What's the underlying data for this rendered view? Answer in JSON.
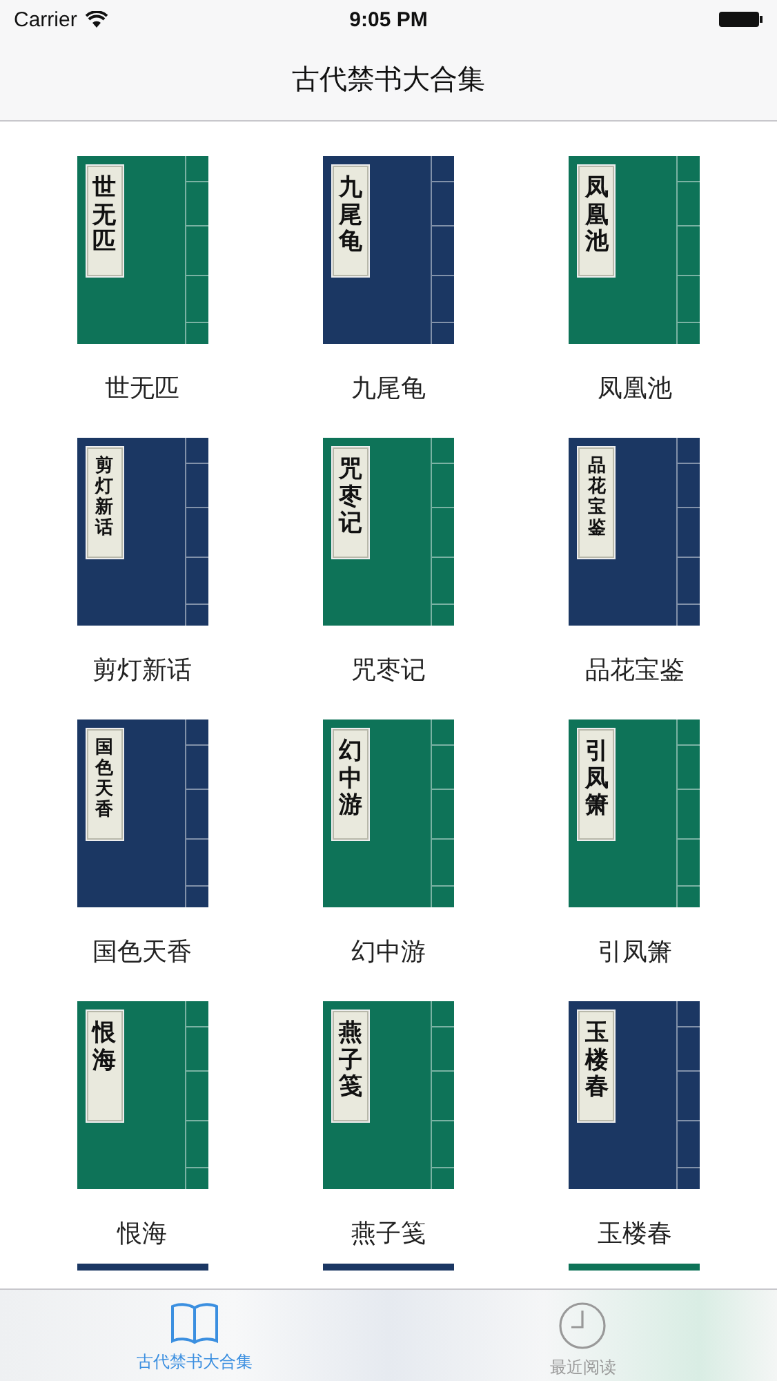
{
  "status_bar": {
    "carrier": "Carrier",
    "time": "9:05 PM"
  },
  "nav_bar": {
    "title": "古代禁书大合集"
  },
  "books": [
    {
      "title": "世无匹",
      "cover_title": "世无匹",
      "color": "#0e7358"
    },
    {
      "title": "九尾龟",
      "cover_title": "九尾龟",
      "color": "#1b3763"
    },
    {
      "title": "凤凰池",
      "cover_title": "凤凰池",
      "color": "#0e7358"
    },
    {
      "title": "剪灯新话",
      "cover_title": "剪灯新话",
      "color": "#1b3763"
    },
    {
      "title": "咒枣记",
      "cover_title": "咒枣记",
      "color": "#0e7358"
    },
    {
      "title": "品花宝鉴",
      "cover_title": "品花宝鉴",
      "color": "#1b3763"
    },
    {
      "title": "国色天香",
      "cover_title": "国色天香",
      "color": "#1b3763"
    },
    {
      "title": "幻中游",
      "cover_title": "幻中游",
      "color": "#0e7358"
    },
    {
      "title": "引凤箫",
      "cover_title": "引凤箫",
      "color": "#0e7358"
    },
    {
      "title": "恨海",
      "cover_title": "恨海",
      "color": "#0e7358"
    },
    {
      "title": "燕子笺",
      "cover_title": "燕子笺",
      "color": "#0e7358"
    },
    {
      "title": "玉楼春",
      "cover_title": "玉楼春",
      "color": "#1b3763"
    }
  ],
  "partial_row": [
    {
      "color": "#1b3763"
    },
    {
      "color": "#1b3763"
    },
    {
      "color": "#0e7358"
    }
  ],
  "tab_bar": [
    {
      "label": "古代禁书大合集",
      "kind": "book",
      "selected": true
    },
    {
      "label": "最近阅读",
      "kind": "clock",
      "selected": false
    }
  ]
}
